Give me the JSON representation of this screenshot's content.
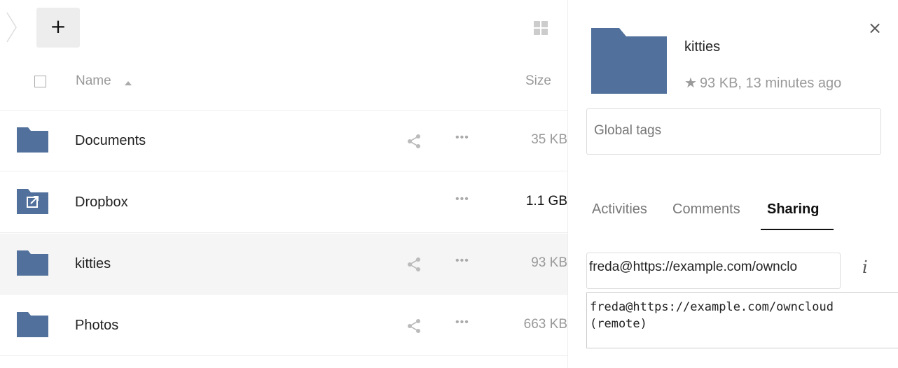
{
  "toolbar": {
    "new_label": "+",
    "breadcrumb_icon": "chevron-right-icon",
    "view_toggle_icon": "grid-icon"
  },
  "list_header": {
    "name_label": "Name",
    "size_label": "Size",
    "sort_icon": "sort-ascending-icon"
  },
  "files": [
    {
      "name": "Documents",
      "size": "35 KB",
      "icon": "folder-icon",
      "shared": true,
      "selected": false
    },
    {
      "name": "Dropbox",
      "size": "1.1 GB",
      "icon": "external-storage-folder-icon",
      "shared": false,
      "selected": false
    },
    {
      "name": "kitties",
      "size": "93 KB",
      "icon": "folder-icon",
      "shared": true,
      "selected": true
    },
    {
      "name": "Photos",
      "size": "663 KB",
      "icon": "folder-icon",
      "shared": true,
      "selected": false
    }
  ],
  "details": {
    "title": "kitties",
    "meta": "93 KB, 13 minutes ago",
    "tags_placeholder": "Global tags",
    "tabs": [
      {
        "label": "Activities"
      },
      {
        "label": "Comments"
      },
      {
        "label": "Sharing"
      }
    ],
    "share_input_value": "freda@https://example.com/ownclo",
    "suggestion": "freda@https://example.com/owncloud\n(remote)",
    "info_label": "i",
    "close_label": "×"
  },
  "colors": {
    "folder": "#51709c",
    "text": "#222222",
    "muted": "#999999",
    "selected_row": "#f5f5f5"
  }
}
